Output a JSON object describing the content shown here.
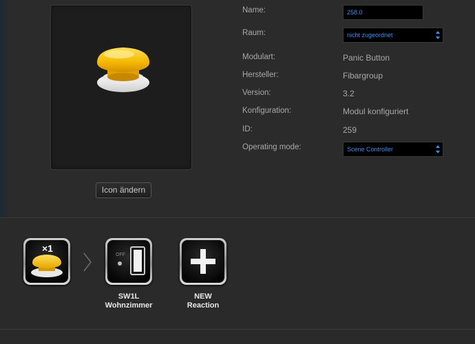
{
  "preview": {
    "icon": "panic-button-yellow",
    "change_icon_label": "Icon ändern"
  },
  "properties": {
    "name_label": "Name:",
    "name_value": "258.0",
    "room_label": "Raum:",
    "room_value": "nicht zugeordnet",
    "module_type_label": "Modulart:",
    "module_type_value": "Panic Button",
    "manufacturer_label": "Hersteller:",
    "manufacturer_value": "Fibargroup",
    "version_label": "Version:",
    "version_value": "3.2",
    "config_label": "Konfiguration:",
    "config_value": "Modul konfiguriert",
    "id_label": "ID:",
    "id_value": "259",
    "mode_label": "Operating mode:",
    "mode_value": "Scene Controller"
  },
  "scene": {
    "trigger": {
      "icon": "panic-button-yellow",
      "badge": "×1"
    },
    "actions": [
      {
        "icon": "wall-switch-icon",
        "switch_state": "OFF",
        "line1": "SW1L",
        "line2": "Wohnzimmer"
      },
      {
        "icon": "plus-icon",
        "line1": "NEW",
        "line2": "Reaction"
      }
    ]
  },
  "colors": {
    "background": "#2a2a2a",
    "field_text": "#3f8ef2",
    "button_yellow": "#f5b800"
  }
}
